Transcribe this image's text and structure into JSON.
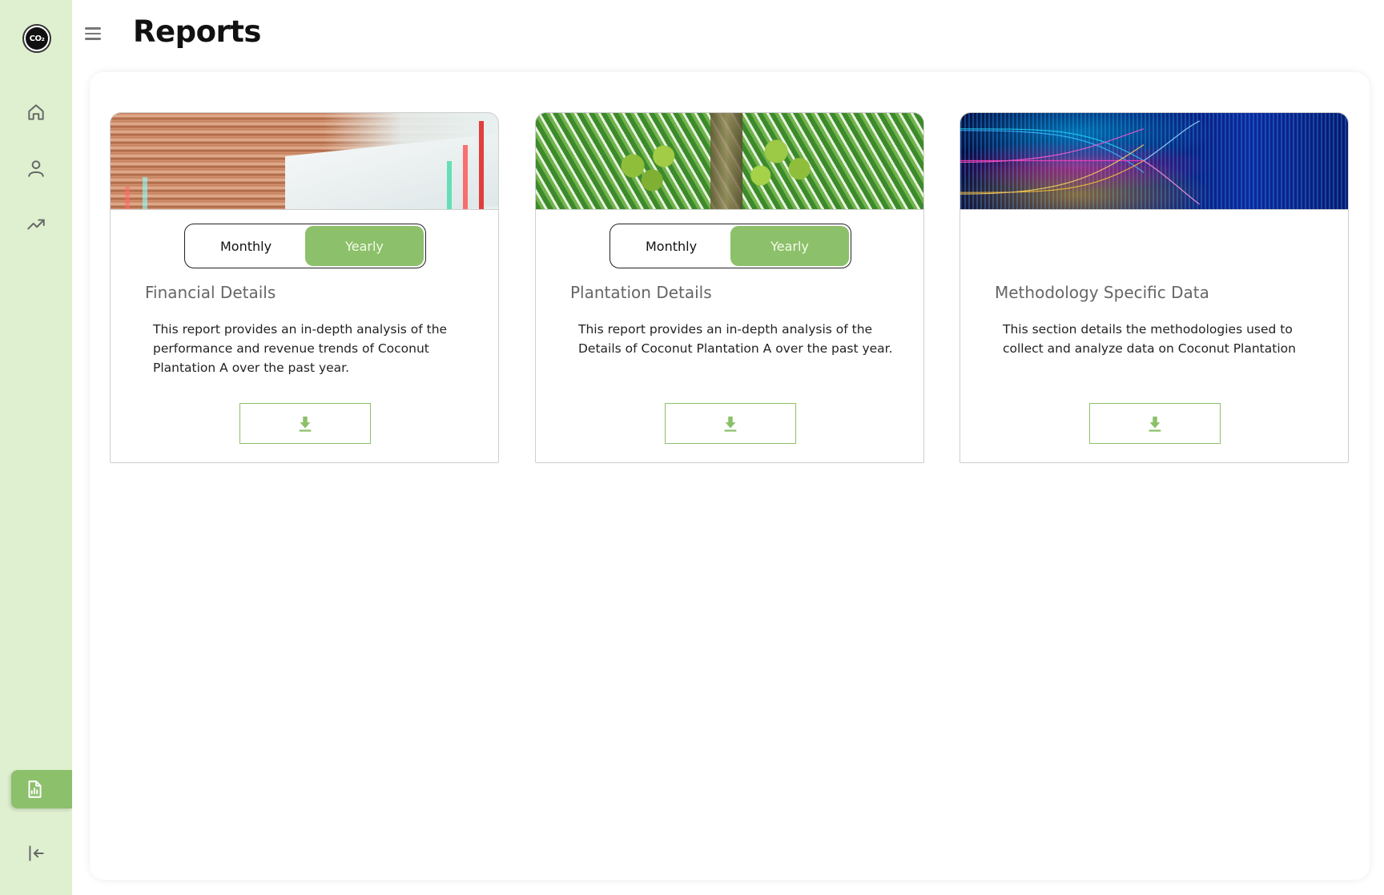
{
  "header": {
    "title": "Reports"
  },
  "sidebar": {
    "logo_text": "CO₂",
    "items": [
      {
        "name": "home",
        "icon": "home-icon"
      },
      {
        "name": "profile",
        "icon": "user-icon"
      },
      {
        "name": "analytics",
        "icon": "trending-up-icon"
      },
      {
        "name": "reports",
        "icon": "report-icon",
        "active": true
      },
      {
        "name": "logout",
        "icon": "logout-icon"
      }
    ]
  },
  "cards": [
    {
      "title": "Financial Details",
      "description": "This report provides an in-depth analysis of the performance and revenue trends of Coconut Plantation A over the past year.",
      "toggle": {
        "monthly": "Monthly",
        "yearly": "Yearly",
        "selected": "Yearly"
      },
      "image": "coins-and-financial-chart"
    },
    {
      "title": "Plantation Details",
      "description": "This report provides an in-depth analysis of the Details of Coconut Plantation A over the past year.",
      "toggle": {
        "monthly": "Monthly",
        "yearly": "Yearly",
        "selected": "Yearly"
      },
      "image": "coconut-palm"
    },
    {
      "title": "Methodology Specific Data",
      "description": "This section details the methodologies used to collect and analyze data on Coconut Plantation",
      "image": "data-visualization"
    }
  ],
  "colors": {
    "sidebar_bg": "#dff0d0",
    "accent": "#8cc06a",
    "title_text": "#111111"
  }
}
